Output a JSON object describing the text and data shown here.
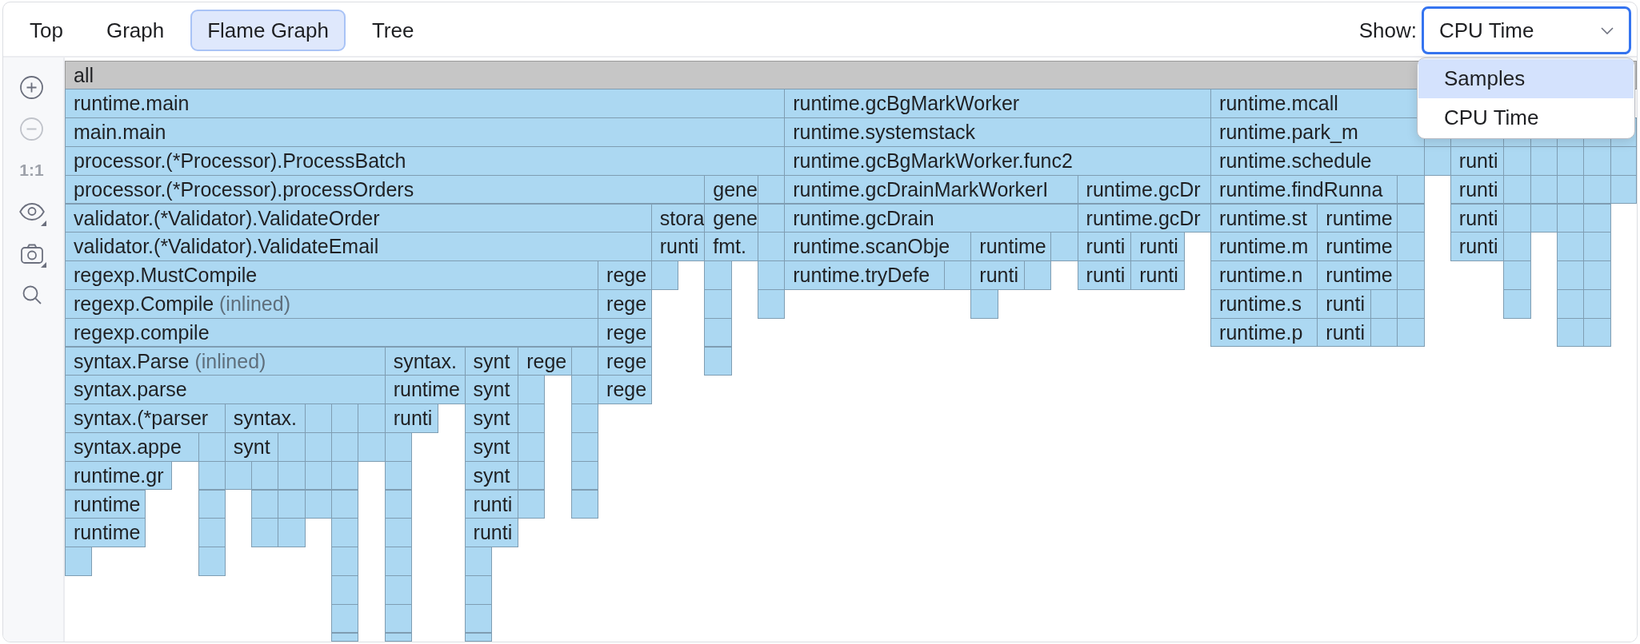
{
  "tabs": [
    {
      "label": "Top",
      "selected": false
    },
    {
      "label": "Graph",
      "selected": false
    },
    {
      "label": "Flame Graph",
      "selected": true
    },
    {
      "label": "Tree",
      "selected": false
    }
  ],
  "show_select": {
    "label": "Show:",
    "value": "CPU Time",
    "focused": true,
    "expanded": true,
    "options": [
      {
        "label": "Samples",
        "highlighted": true
      },
      {
        "label": "CPU Time",
        "highlighted": false
      }
    ]
  },
  "toolbar": [
    {
      "kind": "zoom-in",
      "disabled": false,
      "menu": false
    },
    {
      "kind": "zoom-out",
      "disabled": true,
      "menu": false
    },
    {
      "kind": "actual-size",
      "label": "1:1",
      "disabled": true,
      "menu": false
    },
    {
      "kind": "eye",
      "disabled": false,
      "menu": true
    },
    {
      "kind": "camera",
      "disabled": false,
      "menu": true
    },
    {
      "kind": "search",
      "disabled": false,
      "menu": false
    }
  ],
  "flame_graph": {
    "root": {
      "label": "all"
    },
    "levels": [
      {
        "frames": [
          {
            "label": "runtime.main"
          },
          {
            "label": "runtime.gcBgMarkWorker"
          },
          {
            "label": "runtime.mcall"
          }
        ]
      },
      {
        "frames": [
          {
            "label": "main.main"
          },
          {
            "label": "runtime.systemstack"
          },
          {
            "label": "runtime.park_m"
          }
        ]
      },
      {
        "frames": [
          {
            "label": "processor.(*Processor).ProcessBatch"
          },
          {
            "label": "runtime.gcBgMarkWorker.func2"
          },
          {
            "label": "runtime.schedule"
          },
          {
            "label": "runti"
          }
        ]
      },
      {
        "frames": [
          {
            "label": "processor.(*Processor).processOrders"
          },
          {
            "label": "gene"
          },
          {
            "label": "runtime.gcDrainMarkWorkerI"
          },
          {
            "label": "runtime.gcDr"
          },
          {
            "label": "runtime.findRunna"
          },
          {
            "label": "runti"
          }
        ]
      },
      {
        "frames": [
          {
            "label": "validator.(*Validator).ValidateOrder"
          },
          {
            "label": "stora"
          },
          {
            "label": "gene"
          },
          {
            "label": "runtime.gcDrain"
          },
          {
            "label": "runtime.gcDr"
          },
          {
            "label": "runtime.st"
          },
          {
            "label": "runtime"
          },
          {
            "label": "runti"
          }
        ]
      },
      {
        "frames": [
          {
            "label": "validator.(*Validator).ValidateEmail"
          },
          {
            "label": "runti"
          },
          {
            "label": "fmt."
          },
          {
            "label": "runtime.scanObje"
          },
          {
            "label": "runtime"
          },
          {
            "label": "runti"
          },
          {
            "label": "runti"
          },
          {
            "label": "runtime.m"
          },
          {
            "label": "runtime"
          },
          {
            "label": "runti"
          }
        ]
      },
      {
        "frames": [
          {
            "label": "regexp.MustCompile"
          },
          {
            "label": "rege"
          },
          {
            "label": "runtime.tryDefe"
          },
          {
            "label": "runti"
          },
          {
            "label": "runti"
          },
          {
            "label": "runti"
          },
          {
            "label": "runtime.n"
          },
          {
            "label": "runtime"
          }
        ]
      },
      {
        "frames": [
          {
            "label": "regexp.Compile",
            "note": "(inlined)"
          },
          {
            "label": "rege"
          },
          {
            "label": "runtime.s"
          },
          {
            "label": "runti"
          }
        ]
      },
      {
        "frames": [
          {
            "label": "regexp.compile"
          },
          {
            "label": "rege"
          },
          {
            "label": "runtime.p"
          },
          {
            "label": "runti"
          }
        ]
      },
      {
        "frames": [
          {
            "label": "syntax.Parse",
            "note": "(inlined)"
          },
          {
            "label": "syntax."
          },
          {
            "label": "synt"
          },
          {
            "label": "rege"
          },
          {
            "label": "rege"
          }
        ]
      },
      {
        "frames": [
          {
            "label": "syntax.parse"
          },
          {
            "label": "runtime"
          },
          {
            "label": "synt"
          },
          {
            "label": "rege"
          }
        ]
      },
      {
        "frames": [
          {
            "label": "syntax.(*parser"
          },
          {
            "label": "syntax."
          },
          {
            "label": "runti"
          },
          {
            "label": "synt"
          }
        ]
      },
      {
        "frames": [
          {
            "label": "syntax.appe"
          },
          {
            "label": "synt"
          },
          {
            "label": "synt"
          }
        ]
      },
      {
        "frames": [
          {
            "label": "runtime.gr"
          },
          {
            "label": "synt"
          }
        ]
      },
      {
        "frames": [
          {
            "label": "runtime"
          },
          {
            "label": "runti"
          }
        ]
      },
      {
        "frames": [
          {
            "label": "runtime"
          },
          {
            "label": "runti"
          }
        ]
      }
    ]
  }
}
